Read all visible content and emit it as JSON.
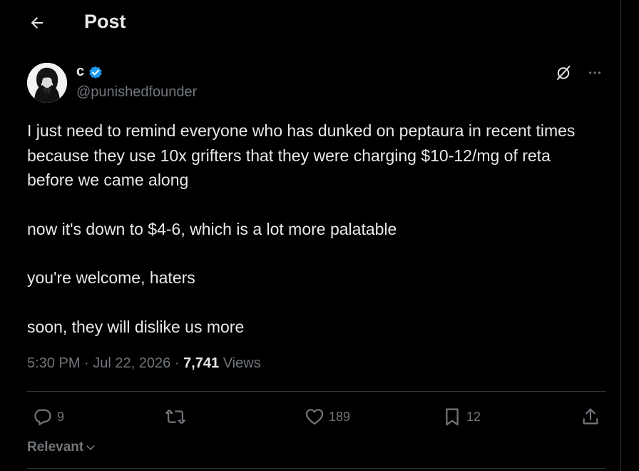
{
  "header": {
    "title": "Post",
    "back_icon": "arrow-left-icon"
  },
  "author": {
    "name": "c",
    "handle": "@punishedfounder",
    "verified": true,
    "verified_color": "#1d9bf0"
  },
  "post": {
    "paragraphs": [
      "I just need to remind everyone who has dunked on peptaura in recent times because they use 10x grifters that they were charging $10-12/mg of reta before we came along",
      "now it's down to $4-6, which is a lot more palatable",
      "you're welcome, haters",
      "soon, they will dislike us more"
    ],
    "time": "5:30 PM",
    "date": "Jul 22, 2026",
    "separator": "·",
    "views_count": "7,741",
    "views_label": "Views"
  },
  "actions": {
    "replies": "9",
    "reposts": "",
    "likes": "189",
    "bookmarks": "12"
  },
  "sort": {
    "label": "Relevant"
  },
  "colors": {
    "background": "#000000",
    "text": "#e7e9ea",
    "muted": "#71767b",
    "border": "#2f3336"
  }
}
